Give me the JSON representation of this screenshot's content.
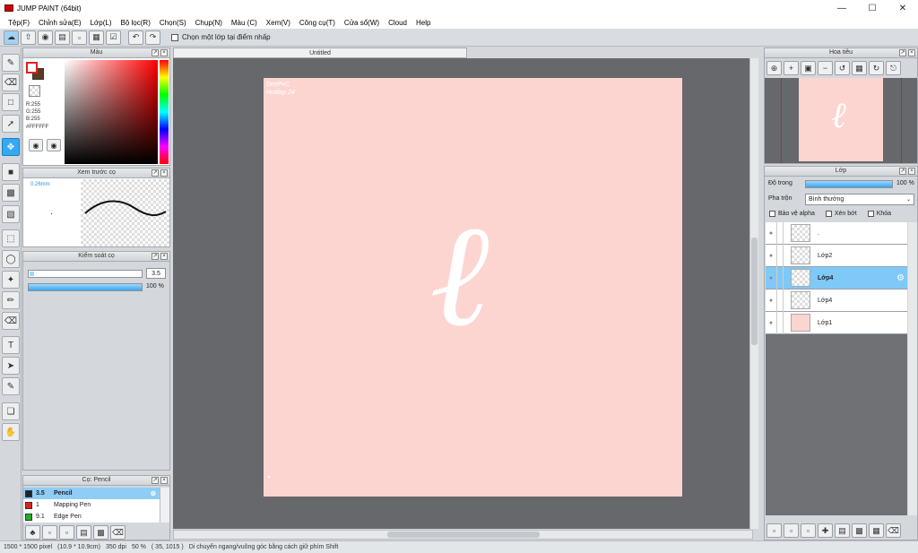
{
  "window": {
    "title": "JUMP PAINT (64bit)"
  },
  "menu": [
    "Tệp(F)",
    "Chỉnh sửa(E)",
    "Lớp(L)",
    "Bộ lọc(R)",
    "Chọn(S)",
    "Chụp(N)",
    "Màu (C)",
    "Xem(V)",
    "Công cụ(T)",
    "Cửa sổ(W)",
    "Cloud",
    "Help"
  ],
  "toolbar": {
    "checkbox_label": "Chọn một lớp tại điểm nhấp"
  },
  "document": {
    "tab_title": "Untitled"
  },
  "color_panel": {
    "title": "Màu",
    "r": "R:255",
    "g": "G:255",
    "b": "B:255",
    "hex": "#FFFFFF",
    "main_color": "#ffffff",
    "sub_color": "#5a3a22"
  },
  "brush_preview": {
    "title": "Xem trước cọ",
    "size_label": "0.26mm"
  },
  "brush_control": {
    "title": "Kiểm soát cọ",
    "size_value": "3.5",
    "opacity_value": "100 %",
    "opacity_fraction": 1.0
  },
  "brush_list": {
    "title": "Cọ: Pencil",
    "items": [
      {
        "size": "3.5",
        "name": "Pencil",
        "color": "#222222",
        "selected": true
      },
      {
        "size": "1",
        "name": "Mapping Pen",
        "color": "#e02020",
        "selected": false
      },
      {
        "size": "9.1",
        "name": "Edge Pen",
        "color": "#20b020",
        "selected": false
      }
    ]
  },
  "navigator": {
    "title": "Hoa tiêu"
  },
  "layers_panel": {
    "title": "Lớp",
    "opacity_label": "Độ trong",
    "opacity_value": "100 %",
    "opacity_fraction": 1.0,
    "blend_label": "Pha trộn",
    "blend_value": "Bình thường",
    "protect_alpha": "Bảo vệ alpha",
    "clipping": "Xén bớt",
    "lock": "Khóa",
    "layers": [
      {
        "name": ".",
        "selected": false,
        "thumb": "checker"
      },
      {
        "name": "Lớp2",
        "selected": false,
        "thumb": "checker"
      },
      {
        "name": "Lớp4",
        "selected": true,
        "thumb": "checker"
      },
      {
        "name": "Lớp4",
        "selected": false,
        "thumb": "checker"
      },
      {
        "name": "Lớp1",
        "selected": false,
        "thumb": "pink"
      }
    ]
  },
  "artwork": {
    "watermark_line1": "DeePvC",
    "watermark_line2": "Hoàlap 24",
    "glyph": "ℓ",
    "background": "#fdd5d0"
  },
  "statusbar": {
    "size": "1500 * 1500 pixel",
    "physical": "(10.9 * 10.9cm)",
    "dpi": "350 dpi",
    "zoom": "50 %",
    "coords": "( 35, 1015 )",
    "hint": "Di chuyển ngang/vuông góc bằng cách giữ phím Shift"
  }
}
